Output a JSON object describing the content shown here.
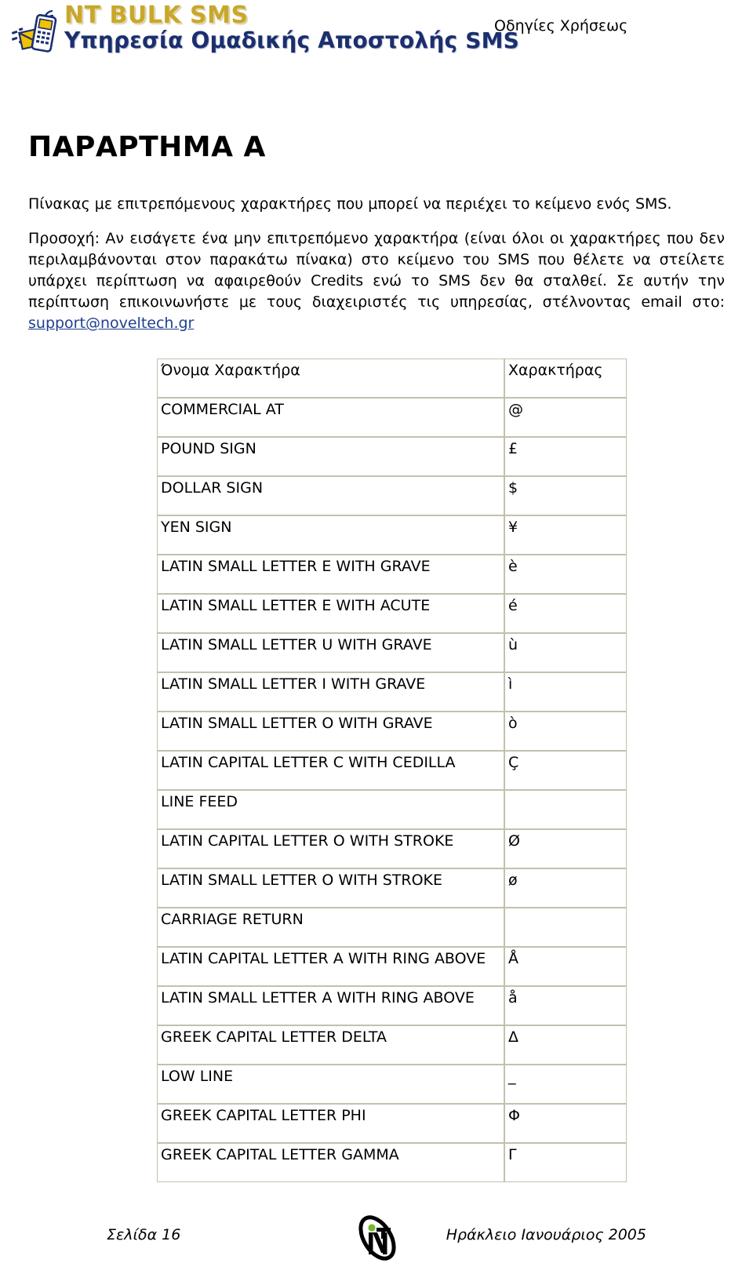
{
  "header": {
    "brand_line1": "NT BULK SMS",
    "brand_line2": "Υπηρεσία Ομαδικής Αποστολής SMS",
    "doc_kind": "Οδηγίες Χρήσεως",
    "logo_icon": "mobile-phone-envelope-icon",
    "brand_gold": "#c8a72c",
    "brand_navy": "#1b2f6e"
  },
  "main": {
    "title": "ΠΑΡΑΡΤΗΜΑ Α",
    "intro": "Πίνακας με επιτρεπόμενους χαρακτήρες που μπορεί να περιέχει το κείμενο ενός SMS.",
    "warning": "Προσοχή: Αν εισάγετε ένα μην επιτρεπόμενο χαρακτήρα (είναι όλοι οι χαρακτήρες που δεν περιλαμβάνονται στον παρακάτω πίνακα) στο κείμενο του SMS που θέλετε να στείλετε υπάρχει περίπτωση να αφαιρεθούν Credits ενώ το SMS δεν θα σταλθεί. Σε αυτήν την περίπτωση επικοινωνήστε με τους διαχειριστές τις υπηρεσίας, στέλνοντας email στο:",
    "support_email": "support@noveltech.gr",
    "link_color": "#1f3f8f"
  },
  "table": {
    "headers": [
      "Όνομα Χαρακτήρα",
      "Χαρακτήρας"
    ],
    "border_color": "#c3c0ae",
    "rows": [
      {
        "name": "COMMERCIAL AT",
        "char": "@"
      },
      {
        "name": "POUND SIGN",
        "char": "£"
      },
      {
        "name": "DOLLAR SIGN",
        "char": "$"
      },
      {
        "name": "YEN SIGN",
        "char": "¥"
      },
      {
        "name": "LATIN SMALL LETTER E WITH GRAVE",
        "char": "è"
      },
      {
        "name": "LATIN SMALL LETTER E WITH ACUTE",
        "char": "é"
      },
      {
        "name": "LATIN SMALL LETTER U WITH GRAVE",
        "char": "ù"
      },
      {
        "name": "LATIN SMALL LETTER I WITH GRAVE",
        "char": "ì"
      },
      {
        "name": "LATIN SMALL LETTER O WITH GRAVE",
        "char": "ò"
      },
      {
        "name": "LATIN CAPITAL LETTER C WITH CEDILLA",
        "char": "Ç"
      },
      {
        "name": "LINE FEED",
        "char": ""
      },
      {
        "name": "LATIN CAPITAL LETTER O WITH STROKE",
        "char": "Ø"
      },
      {
        "name": "LATIN SMALL LETTER O WITH STROKE",
        "char": "ø"
      },
      {
        "name": "CARRIAGE RETURN",
        "char": ""
      },
      {
        "name": "LATIN CAPITAL LETTER A WITH RING ABOVE",
        "char": "Å"
      },
      {
        "name": "LATIN SMALL LETTER A WITH RING ABOVE",
        "char": "å"
      },
      {
        "name": "GREEK CAPITAL LETTER DELTA",
        "char": "Δ"
      },
      {
        "name": "LOW LINE",
        "char": "_"
      },
      {
        "name": "GREEK CAPITAL LETTER PHI",
        "char": "Φ"
      },
      {
        "name": "GREEK CAPITAL LETTER GAMMA",
        "char": "Γ"
      }
    ]
  },
  "footer": {
    "page_label": "Σελίδα 16",
    "place_date": "Ηράκλειο Ιανουάριος 2005",
    "logo_icon": "nt-ellipse-logo-icon"
  }
}
